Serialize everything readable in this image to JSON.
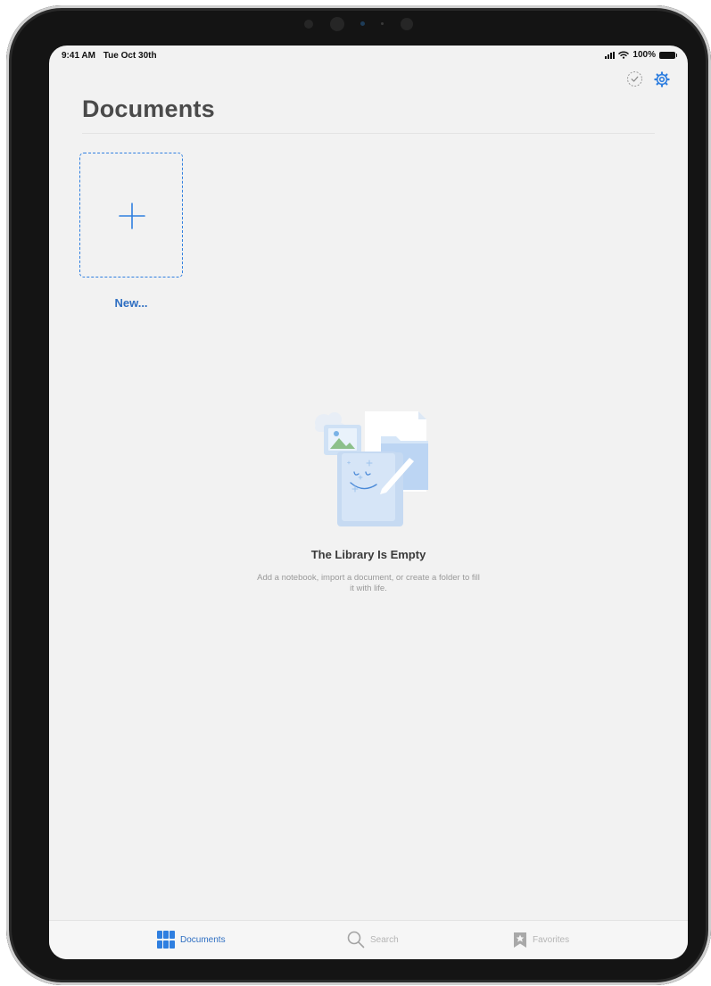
{
  "status_bar": {
    "time": "9:41 AM",
    "date": "Tue Oct 30th",
    "battery": "100%"
  },
  "header": {
    "title": "Documents"
  },
  "new_tile": {
    "label": "New..."
  },
  "empty_state": {
    "title": "The Library Is Empty",
    "subtitle": "Add a notebook, import a document, or create a folder to fill it with life."
  },
  "tabbar": {
    "items": [
      {
        "label": "Documents",
        "icon": "grid-icon",
        "selected": true
      },
      {
        "label": "Search",
        "icon": "search-icon",
        "selected": false
      },
      {
        "label": "Favorites",
        "icon": "bookmark-star-icon",
        "selected": false
      }
    ]
  },
  "colors": {
    "accent": "#2f7fe0",
    "accent_text": "#2f6fc2",
    "background": "#f2f2f2",
    "bezel": "#141414",
    "inactive_tab": "#b5b5b5"
  }
}
